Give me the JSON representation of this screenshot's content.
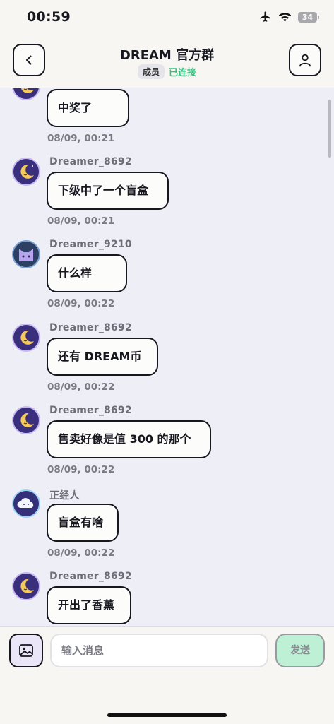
{
  "status_bar": {
    "time": "00:59",
    "battery": "34"
  },
  "header": {
    "title": "DREAM 官方群",
    "role": "成员",
    "connection": "已连接"
  },
  "messages": [
    {
      "sender": "",
      "text": "中奖了",
      "time": "08/09, 00:21",
      "avatar": "moon-avatar"
    },
    {
      "sender": "Dreamer_8692",
      "text": "下级中了一个盲盒",
      "time": "08/09, 00:21",
      "avatar": "moon-avatar"
    },
    {
      "sender": "Dreamer_9210",
      "text": "什么样",
      "time": "08/09, 00:22",
      "avatar": "cat-avatar"
    },
    {
      "sender": "Dreamer_8692",
      "text": "还有 DREAM币",
      "time": "08/09, 00:22",
      "avatar": "moon-avatar"
    },
    {
      "sender": "Dreamer_8692",
      "text": "售卖好像是值 300 的那个",
      "time": "08/09, 00:22",
      "avatar": "moon-avatar"
    },
    {
      "sender": "正经人",
      "text": "盲盒有啥",
      "time": "08/09, 00:22",
      "avatar": "cloud-avatar"
    },
    {
      "sender": "Dreamer_8692",
      "text": "开出了香薰",
      "time": "",
      "avatar": "moon-avatar"
    }
  ],
  "composer": {
    "placeholder": "输入消息",
    "send_label": "发送"
  },
  "colors": {
    "accent_green": "#32c27f",
    "send_bg": "#bdf0d5",
    "bubble_border": "#17171f"
  }
}
